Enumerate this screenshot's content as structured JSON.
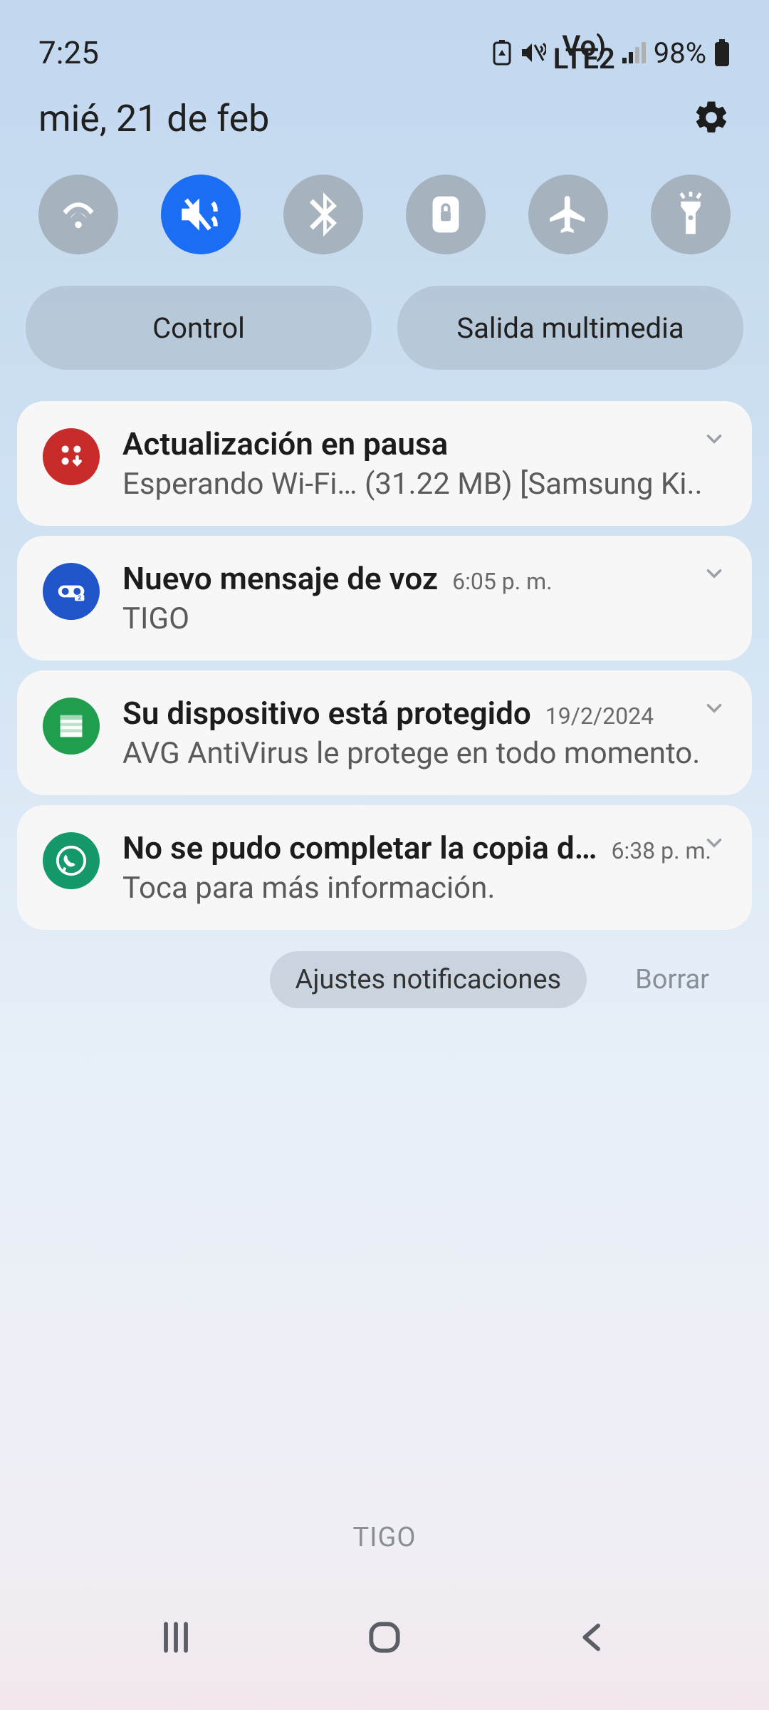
{
  "status": {
    "time": "7:25",
    "battery_text": "98%",
    "network_label": "LTE2",
    "vo_label": "Vo"
  },
  "date": "mié, 21 de feb",
  "toggles": [
    {
      "name": "wifi",
      "active": false
    },
    {
      "name": "mute-vibrate",
      "active": true
    },
    {
      "name": "bluetooth",
      "active": false
    },
    {
      "name": "rotation-lock",
      "active": false
    },
    {
      "name": "airplane",
      "active": false
    },
    {
      "name": "flashlight",
      "active": false
    }
  ],
  "pills": {
    "control": "Control",
    "media_output": "Salida multimedia"
  },
  "notifications": [
    {
      "icon": "update-icon",
      "icon_bg": "#c92a2a",
      "title": "Actualización en pausa",
      "time": "",
      "subtitle": "Esperando Wi-Fi… (31.22 MB) [Samsung Ki.."
    },
    {
      "icon": "voicemail-icon",
      "icon_bg": "#1f55c9",
      "title": "Nuevo mensaje de voz",
      "time": "6:05 p. m.",
      "subtitle": "TIGO"
    },
    {
      "icon": "avg-icon",
      "icon_bg": "#1f9e4e",
      "title": "Su dispositivo está protegido",
      "time": "19/2/2024",
      "subtitle": "AVG AntiVirus le protege en todo momento."
    },
    {
      "icon": "whatsapp-icon",
      "icon_bg": "#15996b",
      "title": "No se pudo completar la copia d…",
      "time": "6:38 p. m.",
      "subtitle": "Toca para más información."
    }
  ],
  "footer": {
    "settings": "Ajustes notificaciones",
    "clear": "Borrar"
  },
  "carrier": "TIGO"
}
